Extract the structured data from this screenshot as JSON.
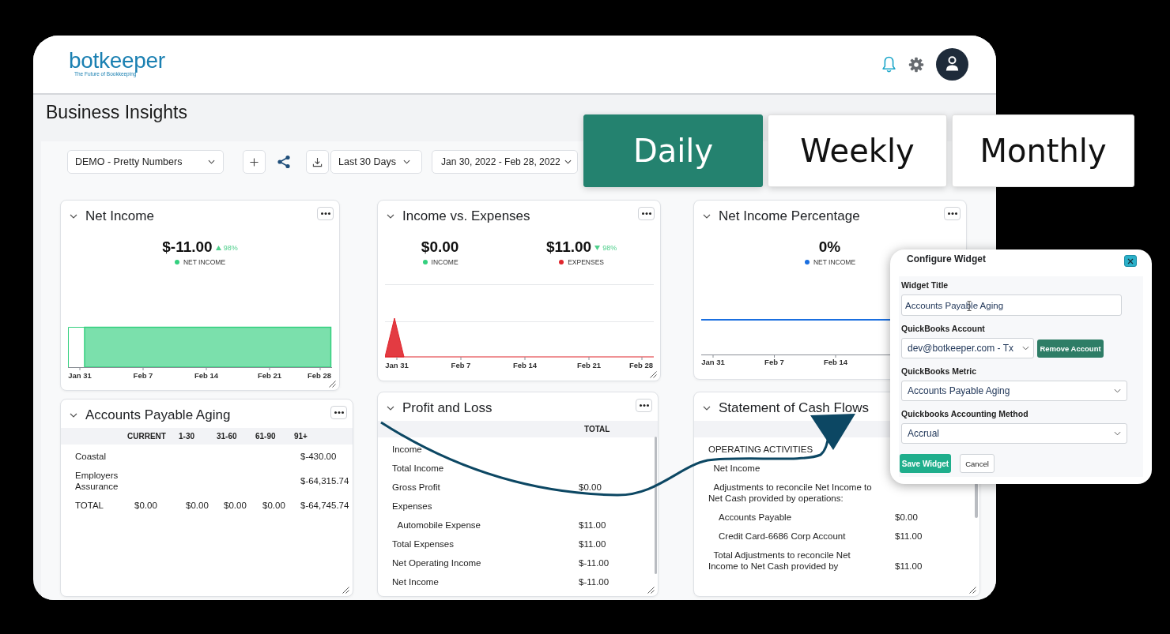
{
  "header": {
    "logo": {
      "wordmark": "botkeeper",
      "tagline": "The Future of Bookkeeping"
    }
  },
  "page_title": "Business Insights",
  "period_tabs": [
    {
      "label": "Daily",
      "selected": true
    },
    {
      "label": "Weekly",
      "selected": false
    },
    {
      "label": "Monthly",
      "selected": false
    }
  ],
  "toolbar": {
    "dashboard": "DEMO - Pretty Numbers",
    "range": "Last 30 Days",
    "dates": "Jan 30, 2022 - Feb 28, 2022"
  },
  "widgets": [
    {
      "kind": "area",
      "title": "Net Income",
      "menu_button": true,
      "metrics": [
        {
          "value": "$-11.00",
          "change": {
            "up": true,
            "value": "98%"
          },
          "legend": "NET INCOME",
          "color": "#34d07f"
        }
      ],
      "x_labels": [
        "Jan 31",
        "Feb 7",
        "Feb 14",
        "Feb 21",
        "Feb 28"
      ]
    },
    {
      "kind": "spike",
      "title": "Income vs. Expenses",
      "menu_button": true,
      "metrics": [
        {
          "value": "$0.00",
          "legend": "INCOME",
          "color": "#34d07f"
        },
        {
          "value": "$11.00",
          "change": {
            "up": false,
            "value": "98%"
          },
          "legend": "EXPENSES",
          "color": "#e0262d"
        }
      ],
      "x_labels": [
        "Jan 31",
        "Feb 7",
        "Feb 14",
        "Feb 21",
        "Feb 28"
      ]
    },
    {
      "kind": "line",
      "title": "Net Income Percentage",
      "menu_button": true,
      "metrics": [
        {
          "value": "0%",
          "legend": "NET INCOME",
          "color": "#1a6fe0"
        }
      ],
      "x_labels": [
        "Jan 31",
        "Feb 7",
        "Feb 14"
      ]
    },
    {
      "kind": "aging",
      "title": "Accounts Payable Aging",
      "menu_button": true,
      "columns": [
        "CURRENT",
        "1-30",
        "31-60",
        "61-90",
        "91+"
      ],
      "rows": [
        {
          "label": "Coastal",
          "days_91_plus": "$-430.00"
        },
        {
          "label": "Employers Assurance",
          "days_91_plus": "$-64,315.74"
        },
        {
          "label": "TOTAL",
          "current": "$0.00",
          "days_1_30": "$0.00",
          "days_31_60": "$0.00",
          "days_61_90": "$0.00",
          "days_91_plus": "$-64,745.74"
        }
      ]
    },
    {
      "kind": "report",
      "title": "Profit and Loss",
      "menu_button": true,
      "columns": [
        "TOTAL"
      ],
      "rows": [
        {
          "label": "Income"
        },
        {
          "label": "Total Income"
        },
        {
          "label": "Gross Profit",
          "value": "$0.00"
        },
        {
          "label": "Expenses",
          "children": [
            {
              "label": "Automobile Expense",
              "value": "$11.00"
            }
          ]
        },
        {
          "label": "Total Expenses",
          "value": "$11.00"
        },
        {
          "label": "Net Operating Income",
          "value": "$-11.00"
        },
        {
          "label": "Net Income",
          "value": "$-11.00"
        }
      ]
    },
    {
      "kind": "report",
      "title": "Statement of Cash Flows",
      "rows": [
        {
          "label": "OPERATING ACTIVITIES",
          "children": [
            {
              "label": "Net Income"
            },
            {
              "label": "Adjustments to reconcile Net Income to Net Cash provided by operations:",
              "children": [
                {
                  "label": "Accounts Payable",
                  "value": "$0.00"
                },
                {
                  "label": "Credit Card-6686 Corp Account",
                  "value": "$11.00"
                }
              ]
            },
            {
              "label": "Total Adjustments to reconcile Net Income to Net Cash provided by",
              "value": "$11.00"
            }
          ]
        }
      ]
    }
  ],
  "configure_widget": {
    "title": "Configure Widget",
    "fields": [
      {
        "kind": "text",
        "label": "Widget Title",
        "value": "Accounts Payable Aging"
      },
      {
        "kind": "combo",
        "label": "QuickBooks Account",
        "value": "dev@botkeeper.com - Tx",
        "button": "Remove Account"
      },
      {
        "kind": "select",
        "label": "QuickBooks Metric",
        "value": "Accounts Payable Aging"
      },
      {
        "kind": "select",
        "label": "Quickbooks Accounting Method",
        "value": "Accrual"
      }
    ],
    "buttons": [
      {
        "kind": "primary",
        "label": "Save Widget"
      },
      {
        "kind": "secondary",
        "label": "Cancel"
      }
    ]
  }
}
